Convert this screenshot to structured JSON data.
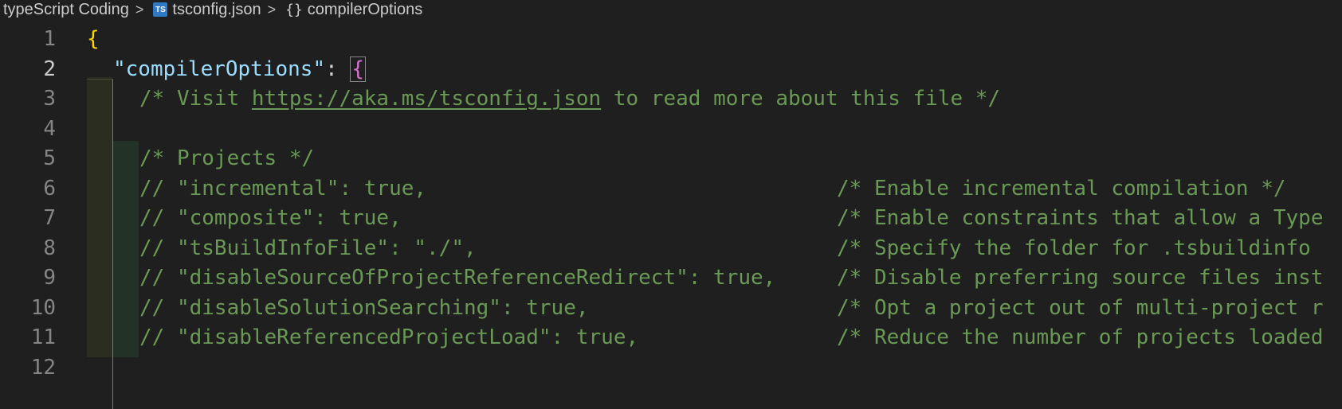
{
  "breadcrumb": {
    "folder": "typeScript Coding",
    "file_icon": "TS",
    "file": "tsconfig.json",
    "symbol_icon": "{}",
    "symbol": "compilerOptions",
    "separator": ">"
  },
  "lines": [
    {
      "num": "1"
    },
    {
      "num": "2"
    },
    {
      "num": "3"
    },
    {
      "num": "4"
    },
    {
      "num": "5"
    },
    {
      "num": "6"
    },
    {
      "num": "7"
    },
    {
      "num": "8"
    },
    {
      "num": "9"
    },
    {
      "num": "10"
    },
    {
      "num": "11"
    },
    {
      "num": "12"
    }
  ],
  "code": {
    "l1_brace": "{",
    "l2_key": "\"compilerOptions\"",
    "l2_colon": ": ",
    "l2_brace": "{",
    "l3_pre": "/* Visit ",
    "l3_link": "https://aka.ms/tsconfig.json",
    "l3_post": " to read more about this file */",
    "l5": "/* Projects */",
    "l6": "// \"incremental\": true,",
    "l6_c": "/* Enable incremental compilation */",
    "l7": "// \"composite\": true,",
    "l7_c": "/* Enable constraints that allow a Type",
    "l8": "// \"tsBuildInfoFile\": \"./\",",
    "l8_c": "/* Specify the folder for .tsbuildinfo",
    "l9": "// \"disableSourceOfProjectReferenceRedirect\": true,",
    "l9_c": "/* Disable preferring source files inst",
    "l10": "// \"disableSolutionSearching\": true,",
    "l10_c": "/* Opt a project out of multi-project r",
    "l11": "// \"disableReferencedProjectLoad\": true,",
    "l11_c": "/* Reduce the number of projects loaded"
  }
}
